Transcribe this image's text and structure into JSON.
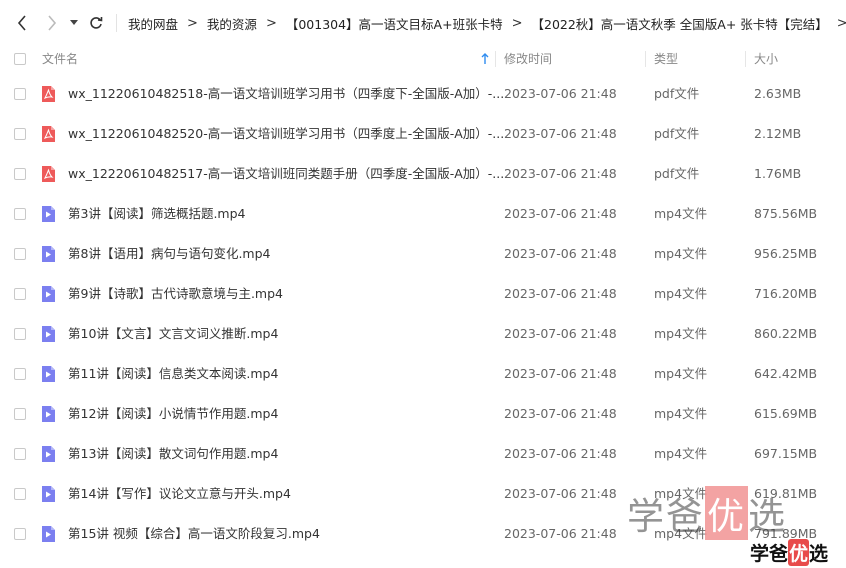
{
  "breadcrumb": {
    "items": [
      "我的网盘",
      "我的资源",
      "【001304】高一语文目标A+班张卡特",
      "【2022秋】高一语文秋季 全国版A+ 张卡特【完结】"
    ],
    "separator": ">"
  },
  "columns": {
    "name": "文件名",
    "modified": "修改时间",
    "type": "类型",
    "size": "大小"
  },
  "files": [
    {
      "name": "wx_11220610482518-高一语文培训班学习用书（四季度下-全国版-A加）-...",
      "modified": "2023-07-06 21:48",
      "type": "pdf文件",
      "size": "2.63MB",
      "icon": "pdf-icon"
    },
    {
      "name": "wx_11220610482520-高一语文培训班学习用书（四季度上-全国版-A加）-...",
      "modified": "2023-07-06 21:48",
      "type": "pdf文件",
      "size": "2.12MB",
      "icon": "pdf-icon"
    },
    {
      "name": "wx_12220610482517-高一语文培训班同类题手册（四季度-全国版-A加）-...",
      "modified": "2023-07-06 21:48",
      "type": "pdf文件",
      "size": "1.76MB",
      "icon": "pdf-icon"
    },
    {
      "name": "第3讲【阅读】筛选概括题.mp4",
      "modified": "2023-07-06 21:48",
      "type": "mp4文件",
      "size": "875.56MB",
      "icon": "video-icon"
    },
    {
      "name": "第8讲【语用】病句与语句变化.mp4",
      "modified": "2023-07-06 21:48",
      "type": "mp4文件",
      "size": "956.25MB",
      "icon": "video-icon"
    },
    {
      "name": "第9讲【诗歌】古代诗歌意境与主.mp4",
      "modified": "2023-07-06 21:48",
      "type": "mp4文件",
      "size": "716.20MB",
      "icon": "video-icon"
    },
    {
      "name": "第10讲【文言】文言文词义推断.mp4",
      "modified": "2023-07-06 21:48",
      "type": "mp4文件",
      "size": "860.22MB",
      "icon": "video-icon"
    },
    {
      "name": "第11讲【阅读】信息类文本阅读.mp4",
      "modified": "2023-07-06 21:48",
      "type": "mp4文件",
      "size": "642.42MB",
      "icon": "video-icon"
    },
    {
      "name": "第12讲【阅读】小说情节作用题.mp4",
      "modified": "2023-07-06 21:48",
      "type": "mp4文件",
      "size": "615.69MB",
      "icon": "video-icon"
    },
    {
      "name": "第13讲【阅读】散文词句作用题.mp4",
      "modified": "2023-07-06 21:48",
      "type": "mp4文件",
      "size": "697.15MB",
      "icon": "video-icon"
    },
    {
      "name": "第14讲【写作】议论文立意与开头.mp4",
      "modified": "2023-07-06 21:48",
      "type": "mp4文件",
      "size": "619.81MB",
      "icon": "video-icon"
    },
    {
      "name": "第15讲 视频【综合】高一语文阶段复习.mp4",
      "modified": "2023-07-06 21:48",
      "type": "mp4文件",
      "size": "791.89MB",
      "icon": "video-icon"
    }
  ],
  "watermark": {
    "a": "学",
    "b": "爸",
    "c": "优",
    "d": "选"
  },
  "logo": {
    "a": "学",
    "b": "爸",
    "c": "优",
    "d": "选"
  },
  "colors": {
    "pdf": "#ee5a5a",
    "video": "#7b7ff0",
    "accent": "#2e8cf0"
  }
}
